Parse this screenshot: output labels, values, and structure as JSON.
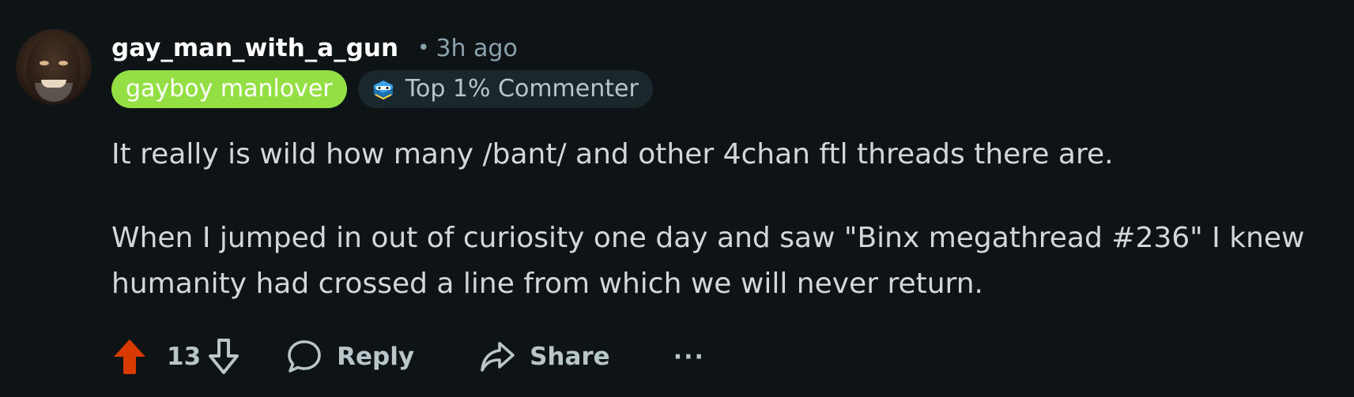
{
  "comment": {
    "username": "gay_man_with_a_gun",
    "separator": "•",
    "time_ago": "3h ago",
    "user_flair": "gayboy manlover",
    "badge_label": "Top 1% Commenter",
    "body": [
      "It really is wild how many /bant/ and other 4chan ftl threads there are.",
      "When I jumped in out of curiosity one day and saw \"Binx megathread #236\" I knew",
      "humanity had crossed a line from which we will never return."
    ]
  },
  "actions": {
    "score": "13",
    "reply_label": "Reply",
    "share_label": "Share",
    "more_label": "···"
  },
  "colors": {
    "background": "#0e1416",
    "upvote_active": "#d93a00",
    "flair_green": "#94e044",
    "badge_bg": "#1a282d",
    "muted_text": "#8ba2ad"
  },
  "icons": {
    "avatar": "avatar-photo",
    "badge": "top-commenter-badge-icon",
    "upvote": "upvote-arrow-icon",
    "downvote": "downvote-arrow-icon",
    "reply": "speech-bubble-icon",
    "share": "share-arrow-icon",
    "more": "ellipsis-icon"
  }
}
